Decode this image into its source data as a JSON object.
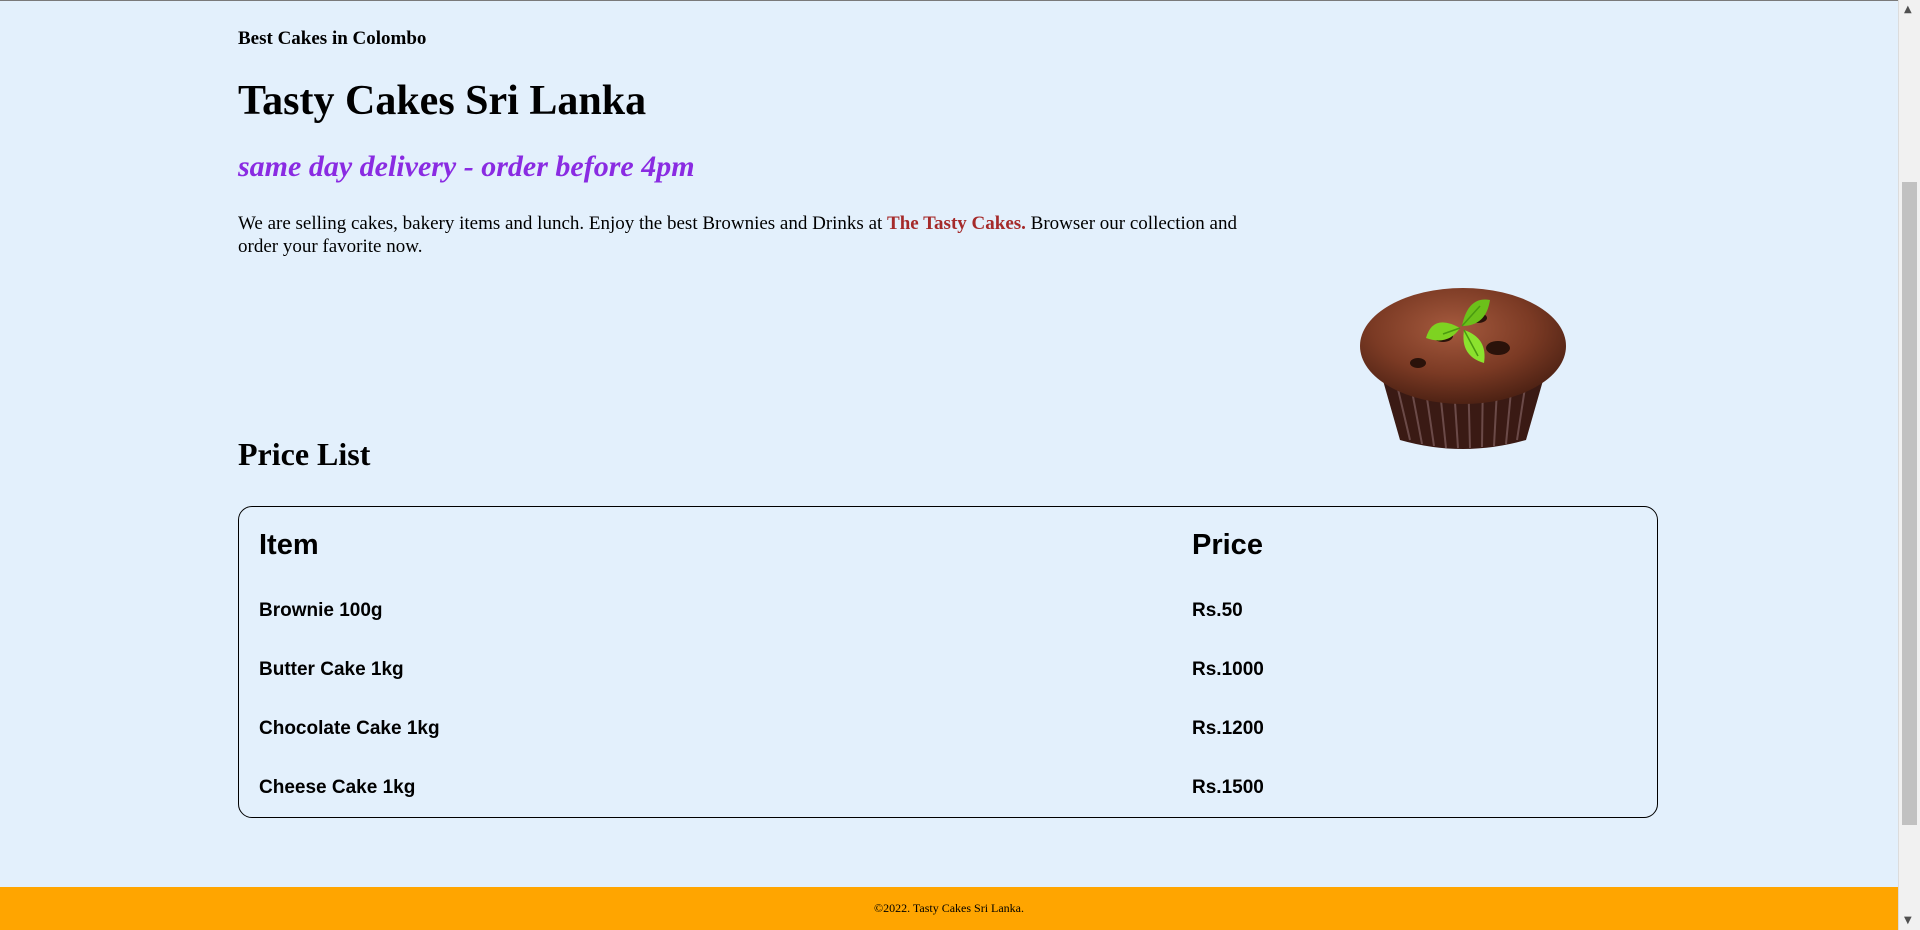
{
  "header": {
    "eyebrow": "Best Cakes in Colombo",
    "title": "Tasty Cakes Sri Lanka",
    "tagline": "same day delivery - order before 4pm"
  },
  "intro": {
    "text_before": "We are selling cakes, bakery items and lunch. Enjoy the best Brownies and Drinks at ",
    "brand": "The Tasty Cakes.",
    "text_after": " Browser our collection and order your favorite now."
  },
  "price_list": {
    "heading": "Price List",
    "columns": [
      "Item",
      "Price"
    ],
    "rows": [
      [
        "Brownie 100g",
        "Rs.50"
      ],
      [
        "Butter Cake 1kg",
        "Rs.1000"
      ],
      [
        "Chocolate Cake 1kg",
        "Rs.1200"
      ],
      [
        "Cheese Cake 1kg",
        "Rs.1500"
      ]
    ]
  },
  "image": {
    "icon": "chocolate-muffin-with-mint"
  },
  "footer": {
    "text": "©2022. Tasty Cakes Sri Lanka."
  },
  "colors": {
    "background": "#e3f0fc",
    "tagline": "#8a2be2",
    "brand": "#a52a2a",
    "footer": "#ffa500"
  }
}
